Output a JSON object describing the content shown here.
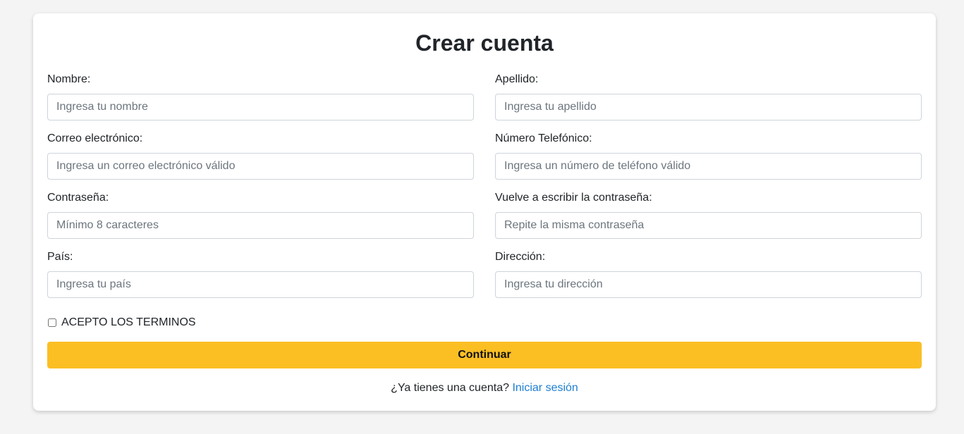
{
  "form": {
    "title": "Crear cuenta",
    "fields": {
      "nombre": {
        "label": "Nombre:",
        "placeholder": "Ingresa tu nombre",
        "value": ""
      },
      "apellido": {
        "label": "Apellido:",
        "placeholder": "Ingresa tu apellido",
        "value": ""
      },
      "correo": {
        "label": "Correo electrónico:",
        "placeholder": "Ingresa un correo electrónico válido",
        "value": ""
      },
      "telefono": {
        "label": "Número Telefónico:",
        "placeholder": "Ingresa un número de teléfono válido",
        "value": ""
      },
      "contrasena": {
        "label": "Contraseña:",
        "placeholder": "Mínimo 8 caracteres",
        "value": ""
      },
      "repetir_contrasena": {
        "label": "Vuelve a escribir la contraseña:",
        "placeholder": "Repite la misma contraseña",
        "value": ""
      },
      "pais": {
        "label": "País:",
        "placeholder": "Ingresa tu país",
        "value": ""
      },
      "direccion": {
        "label": "Dirección:",
        "placeholder": "Ingresa tu dirección",
        "value": ""
      }
    },
    "terms_label": "ACEPTO LOS TERMINOS",
    "terms_checked": false,
    "submit_label": "Continuar",
    "footer_text": "¿Ya tienes una cuenta?",
    "login_link": "Iniciar sesión"
  },
  "colors": {
    "background": "#f4f4f4",
    "card": "#ffffff",
    "accent_button": "#fbbf24",
    "link": "#1d7fd1",
    "input_border": "#ced4da",
    "placeholder": "#6c757d"
  }
}
